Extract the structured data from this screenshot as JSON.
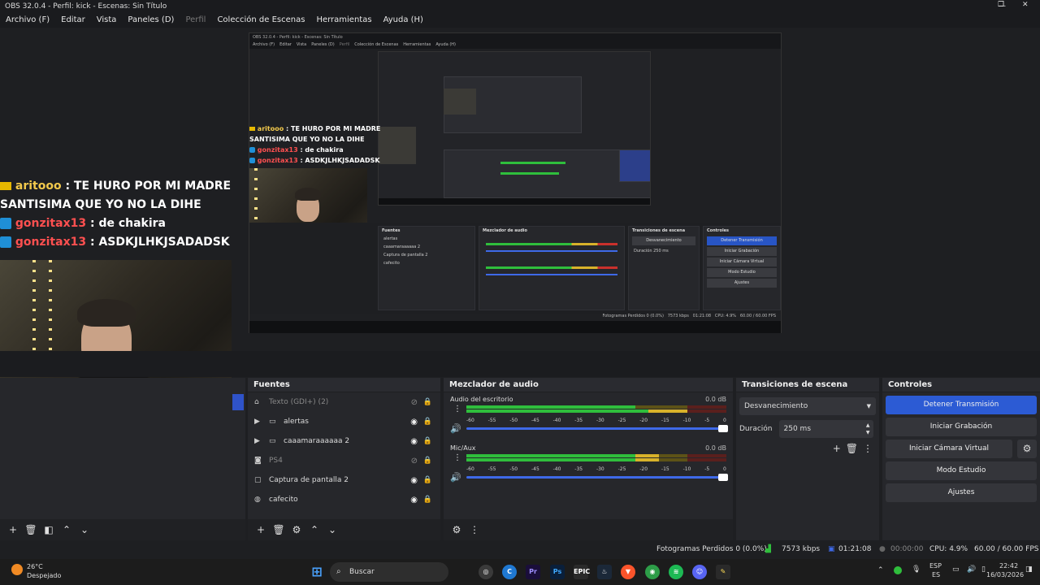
{
  "window": {
    "title": "OBS 32.0.4 - Perfil: kick - Escenas: Sin Título",
    "controls": [
      "—",
      "❐",
      "✕"
    ]
  },
  "menu": [
    {
      "label": "Archivo (F)",
      "enabled": true
    },
    {
      "label": "Editar",
      "enabled": true
    },
    {
      "label": "Vista",
      "enabled": true
    },
    {
      "label": "Paneles (D)",
      "enabled": true
    },
    {
      "label": "Perfil",
      "enabled": false
    },
    {
      "label": "Colección de Escenas",
      "enabled": true
    },
    {
      "label": "Herramientas",
      "enabled": true
    },
    {
      "label": "Ayuda (H)",
      "enabled": true
    }
  ],
  "chat_overlay": [
    {
      "user": "aritooo",
      "text": ": TE HURO POR MI MADRE",
      "text2": "SANTISIMA QUE YO NO LA DIHE",
      "badge": "crown"
    },
    {
      "user": "gonzitax13",
      "text": ": de chakira",
      "badge": "kick"
    },
    {
      "user": "gonzitax13",
      "text": ": ASDKJLHKJSADADSK",
      "badge": "kick"
    }
  ],
  "docks": {
    "sources": {
      "title": "Fuentes",
      "items": [
        {
          "label": "Texto (GDI+) (2)",
          "icon": "text-icon",
          "visible": false,
          "dim": true,
          "expandable": false
        },
        {
          "label": "alertas",
          "icon": "folder-icon",
          "visible": true,
          "dim": false,
          "expandable": true
        },
        {
          "label": "caaamaraaaaaa 2",
          "icon": "folder-icon",
          "visible": true,
          "dim": false,
          "expandable": true
        },
        {
          "label": "PS4",
          "icon": "camera-icon",
          "visible": false,
          "dim": true,
          "expandable": false
        },
        {
          "label": "Captura de pantalla 2",
          "icon": "monitor-icon",
          "visible": true,
          "dim": false,
          "expandable": false
        },
        {
          "label": "cafecito",
          "icon": "globe-icon",
          "visible": true,
          "dim": false,
          "expandable": false
        }
      ]
    },
    "mixer": {
      "title": "Mezclador de audio",
      "channels": [
        {
          "name": "Audio del escritorio",
          "db": "0.0 dB",
          "level": 0.85
        },
        {
          "name": "Mic/Aux",
          "db": "0.0 dB",
          "level": 0.74
        }
      ],
      "scale": [
        "-60",
        "-55",
        "-50",
        "-45",
        "-40",
        "-35",
        "-30",
        "-25",
        "-20",
        "-15",
        "-10",
        "-5",
        "0"
      ]
    },
    "transitions": {
      "title": "Transiciones de escena",
      "selected": "Desvanecimiento",
      "duration_label": "Duración",
      "duration_value": "250 ms"
    },
    "controls": {
      "title": "Controles",
      "buttons": [
        "Detener Transmisión",
        "Iniciar Grabación",
        "Iniciar Cámara Virtual",
        "Modo Estudio",
        "Ajustes"
      ]
    }
  },
  "status": {
    "dropped": "Fotogramas Perdidos 0 (0.0%)",
    "bitrate": "7573 kbps",
    "stream_time": "01:21:08",
    "rec_time": "00:00:00",
    "cpu": "CPU: 4.9%",
    "fps": "60.00 / 60.00 FPS"
  },
  "taskbar": {
    "weather_temp": "26°C",
    "weather_desc": "Despejado",
    "search": "Buscar",
    "lang": "ESP",
    "lang2": "ES",
    "time": "22:42",
    "date": "16/03/2026"
  },
  "colors": {
    "accent_blue": "#2c5bd4",
    "meter_green": "#2fbe3c",
    "meter_yellow": "#d8b22a",
    "meter_red": "#c9302c"
  }
}
